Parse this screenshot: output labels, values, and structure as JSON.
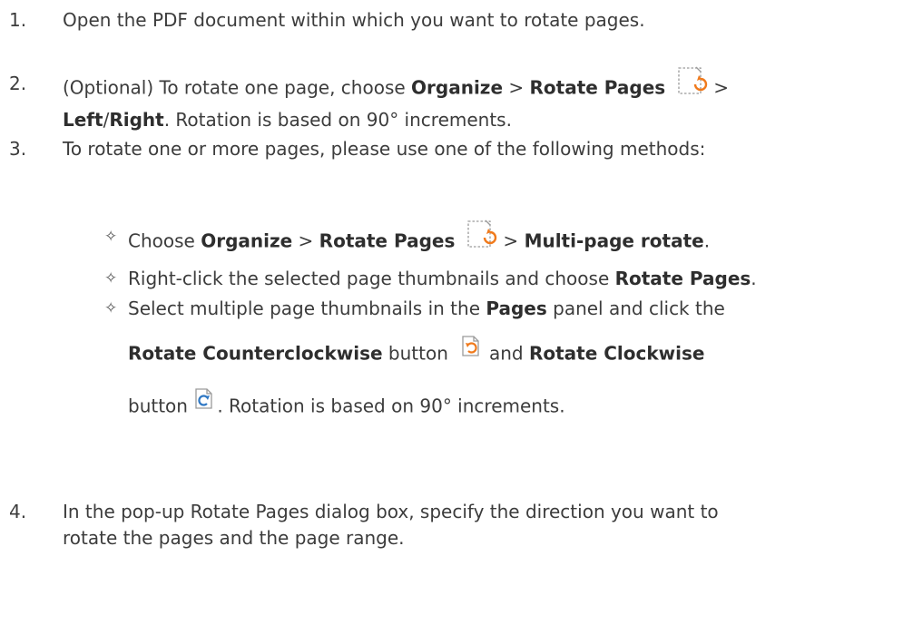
{
  "steps": [
    {
      "number": "1.",
      "text": "Open the PDF document within which you want to rotate pages."
    },
    {
      "number": "2.",
      "a": "(Optional) To rotate one page, choose ",
      "b1": "Organize",
      "sep1": " > ",
      "b2": "Rotate Pages",
      "tail": " >",
      "cont_b1": "Left",
      "cont_slash": "/",
      "cont_b2": "Right",
      "cont_text": ". Rotation is based on 90° increments."
    },
    {
      "number": "3.",
      "text": "To rotate one or more pages, please use one of the following methods:"
    },
    {
      "number": "4.",
      "line1": "In the pop-up Rotate Pages dialog box, specify the direction you want to",
      "line2": "rotate the pages and the page range."
    }
  ],
  "methods": {
    "bullet": "✧",
    "m1": {
      "a": "Choose ",
      "b1": "Organize",
      "sep1": " > ",
      "b2": "Rotate Pages",
      "sep2": " > ",
      "b3": "Multi-page rotate",
      "end": "."
    },
    "m2": {
      "a": "Right-click the selected page thumbnails and choose ",
      "b1": "Rotate Pages",
      "end": "."
    },
    "m3": {
      "a": "Select multiple page thumbnails in the ",
      "b1": "Pages",
      "c": " panel and click the",
      "b2": "Rotate Counterclockwise",
      "d": " button ",
      "e": " and ",
      "b3": "Rotate Clockwise",
      "f": "button ",
      "g": ". Rotation is based on 90° increments."
    }
  },
  "icons": {
    "rotate_pages": "rotate-pages-icon",
    "rotate_ccw": "rotate-counterclockwise-icon",
    "rotate_cw": "rotate-clockwise-icon",
    "accent_orange": "#f07a1c",
    "accent_blue": "#2f78c4"
  }
}
